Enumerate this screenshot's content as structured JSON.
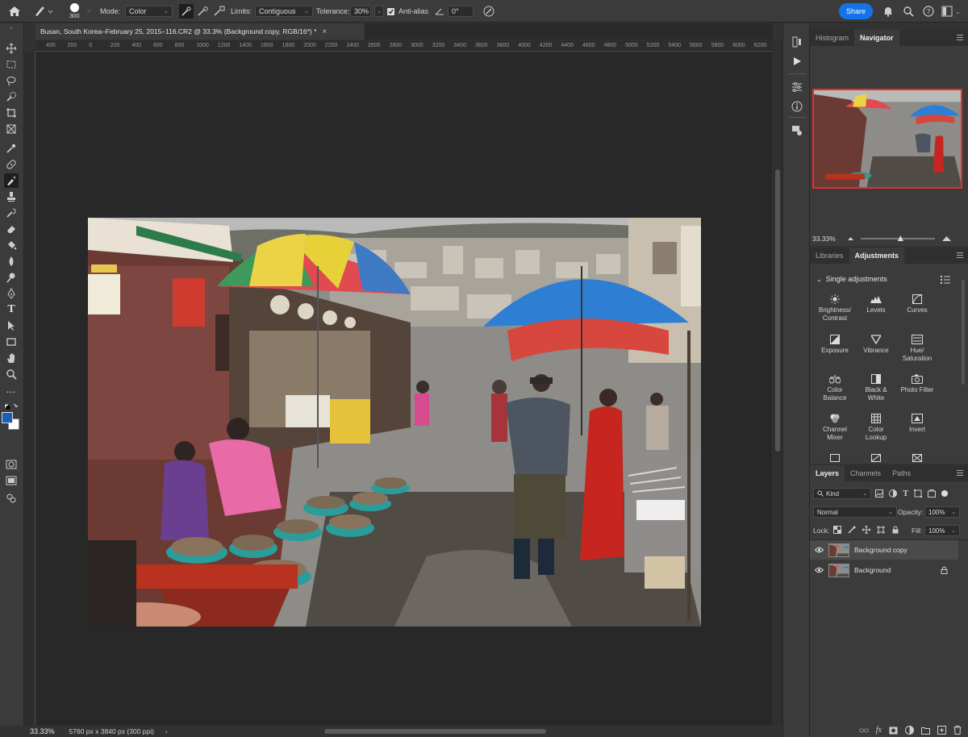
{
  "options_bar": {
    "brush_size": "300",
    "mode_label": "Mode:",
    "mode_value": "Color",
    "limits_label": "Limits:",
    "limits_value": "Contiguous",
    "tolerance_label": "Tolerance:",
    "tolerance_value": "30%",
    "antialias_label": "Anti-alias",
    "angle_value": "0°",
    "share_label": "Share"
  },
  "document": {
    "tab_title": "Busan, South Korea–February 25, 2015–116.CR2 @ 33.3% (Background copy, RGB/16*) *"
  },
  "ruler": {
    "ticks": [
      "400",
      "200",
      "0",
      "200",
      "400",
      "600",
      "800",
      "1000",
      "1200",
      "1400",
      "1600",
      "1800",
      "2000",
      "2200",
      "2400",
      "2600",
      "2800",
      "3000",
      "3200",
      "3400",
      "3600",
      "3800",
      "4000",
      "4200",
      "4400",
      "4600",
      "4800",
      "5000",
      "5200",
      "5400",
      "5600",
      "5800",
      "6000",
      "6200",
      "6400"
    ]
  },
  "status_bar": {
    "zoom": "33.33%",
    "doc_info": "5760 px x 3840 px (300 ppi)"
  },
  "navigator_panel": {
    "tabs": [
      "Histogram",
      "Navigator"
    ],
    "active_tab": "Navigator",
    "zoom": "33.33%"
  },
  "adjustments_panel": {
    "tabs": [
      "Libraries",
      "Adjustments"
    ],
    "active_tab": "Adjustments",
    "section_title": "Single adjustments",
    "items": [
      {
        "label": "Brightness/\nContrast",
        "l1": "Brightness/",
        "l2": "Contrast",
        "icon": "sun-icon"
      },
      {
        "l1": "Levels",
        "l2": "",
        "icon": "levels-icon"
      },
      {
        "l1": "Curves",
        "l2": "",
        "icon": "curves-icon"
      },
      {
        "l1": "Exposure",
        "l2": "",
        "icon": "exposure-icon"
      },
      {
        "l1": "Vibrance",
        "l2": "",
        "icon": "vibrance-icon"
      },
      {
        "l1": "Hue/",
        "l2": "Saturation",
        "icon": "hue-saturation-icon"
      },
      {
        "l1": "Color",
        "l2": "Balance",
        "icon": "color-balance-icon"
      },
      {
        "l1": "Black &",
        "l2": "White",
        "icon": "black-white-icon"
      },
      {
        "l1": "Photo Filter",
        "l2": "",
        "icon": "photo-filter-icon"
      },
      {
        "l1": "Channel",
        "l2": "Mixer",
        "icon": "channel-mixer-icon"
      },
      {
        "l1": "Color",
        "l2": "Lookup",
        "icon": "color-lookup-icon"
      },
      {
        "l1": "Invert",
        "l2": "",
        "icon": "invert-icon"
      }
    ]
  },
  "layers_panel": {
    "tabs": [
      "Layers",
      "Channels",
      "Paths"
    ],
    "active_tab": "Layers",
    "filter_value": "Kind",
    "blend_mode": "Normal",
    "opacity_label": "Opacity:",
    "opacity_value": "100%",
    "lock_label": "Lock:",
    "fill_label": "Fill:",
    "fill_value": "100%",
    "layers": [
      {
        "name": "Background copy",
        "selected": true,
        "locked": false
      },
      {
        "name": "Background",
        "selected": false,
        "locked": true
      }
    ]
  },
  "colors": {
    "foreground": "#1a5fb4",
    "background": "#ffffff",
    "accent": "#1473e6"
  }
}
